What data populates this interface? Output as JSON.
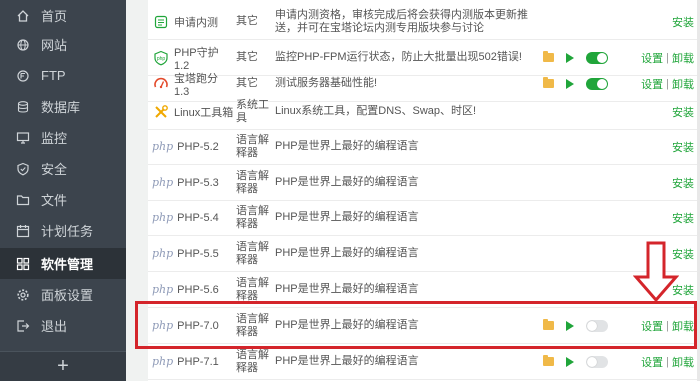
{
  "sidebar": {
    "items": [
      {
        "label": "首页",
        "icon": "home-icon"
      },
      {
        "label": "网站",
        "icon": "globe-icon"
      },
      {
        "label": "FTP",
        "icon": "ftp-icon"
      },
      {
        "label": "数据库",
        "icon": "database-icon"
      },
      {
        "label": "监控",
        "icon": "monitor-icon"
      },
      {
        "label": "安全",
        "icon": "shield-icon"
      },
      {
        "label": "文件",
        "icon": "folder-icon"
      },
      {
        "label": "计划任务",
        "icon": "calendar-icon"
      },
      {
        "label": "软件管理",
        "icon": "grid-icon",
        "active": true
      },
      {
        "label": "面板设置",
        "icon": "gear-icon"
      },
      {
        "label": "退出",
        "icon": "logout-icon"
      }
    ],
    "add_label": "+"
  },
  "software": {
    "rows": [
      {
        "name": "申请内测",
        "icon": "beta-icon",
        "type": "其它",
        "desc": "申请内测资格，审核完成后将会获得内测版本更新推送，并可在宝塔论坛内测专用版块参与讨论",
        "tools": false,
        "ops": [
          "安装"
        ]
      },
      {
        "name": "PHP守护 1.2",
        "icon": "php-guard-icon",
        "type": "其它",
        "desc": "监控PHP-FPM运行状态，防止大批量出现502错误!",
        "tools": true,
        "toggle": "on",
        "ops": [
          "设置",
          "卸载"
        ]
      },
      {
        "name": "宝塔跑分 1.3",
        "icon": "speedometer-icon",
        "type": "其它",
        "desc": "测试服务器基础性能!",
        "tools": true,
        "toggle": "on",
        "ops": [
          "设置",
          "卸载"
        ]
      },
      {
        "name": "Linux工具箱",
        "icon": "tools-icon",
        "type": "系统工具",
        "desc": "Linux系统工具，配置DNS、Swap、时区!",
        "tools": false,
        "ops": [
          "安装"
        ]
      },
      {
        "name": "PHP-5.2",
        "icon": "php-icon",
        "type": "语言解释器",
        "desc": "PHP是世界上最好的编程语言",
        "tools": false,
        "ops": [
          "安装"
        ]
      },
      {
        "name": "PHP-5.3",
        "icon": "php-icon",
        "type": "语言解释器",
        "desc": "PHP是世界上最好的编程语言",
        "tools": false,
        "ops": [
          "安装"
        ]
      },
      {
        "name": "PHP-5.4",
        "icon": "php-icon",
        "type": "语言解释器",
        "desc": "PHP是世界上最好的编程语言",
        "tools": false,
        "ops": [
          "安装"
        ]
      },
      {
        "name": "PHP-5.5",
        "icon": "php-icon",
        "type": "语言解释器",
        "desc": "PHP是世界上最好的编程语言",
        "tools": false,
        "ops": [
          "安装"
        ]
      },
      {
        "name": "PHP-5.6",
        "icon": "php-icon",
        "type": "语言解释器",
        "desc": "PHP是世界上最好的编程语言",
        "tools": false,
        "ops": [
          "安装"
        ]
      },
      {
        "name": "PHP-7.0",
        "icon": "php-icon",
        "type": "语言解释器",
        "desc": "PHP是世界上最好的编程语言",
        "tools": true,
        "toggle": "off",
        "ops": [
          "设置",
          "卸载"
        ]
      },
      {
        "name": "PHP-7.1",
        "icon": "php-icon",
        "type": "语言解释器",
        "desc": "PHP是世界上最好的编程语言",
        "tools": true,
        "toggle": "off",
        "ops": [
          "设置",
          "卸载"
        ]
      }
    ]
  },
  "php_logo_text": "php",
  "colors": {
    "sidebar": "#3c444d",
    "accent": "#20a53a",
    "annotation": "#d4252b"
  }
}
